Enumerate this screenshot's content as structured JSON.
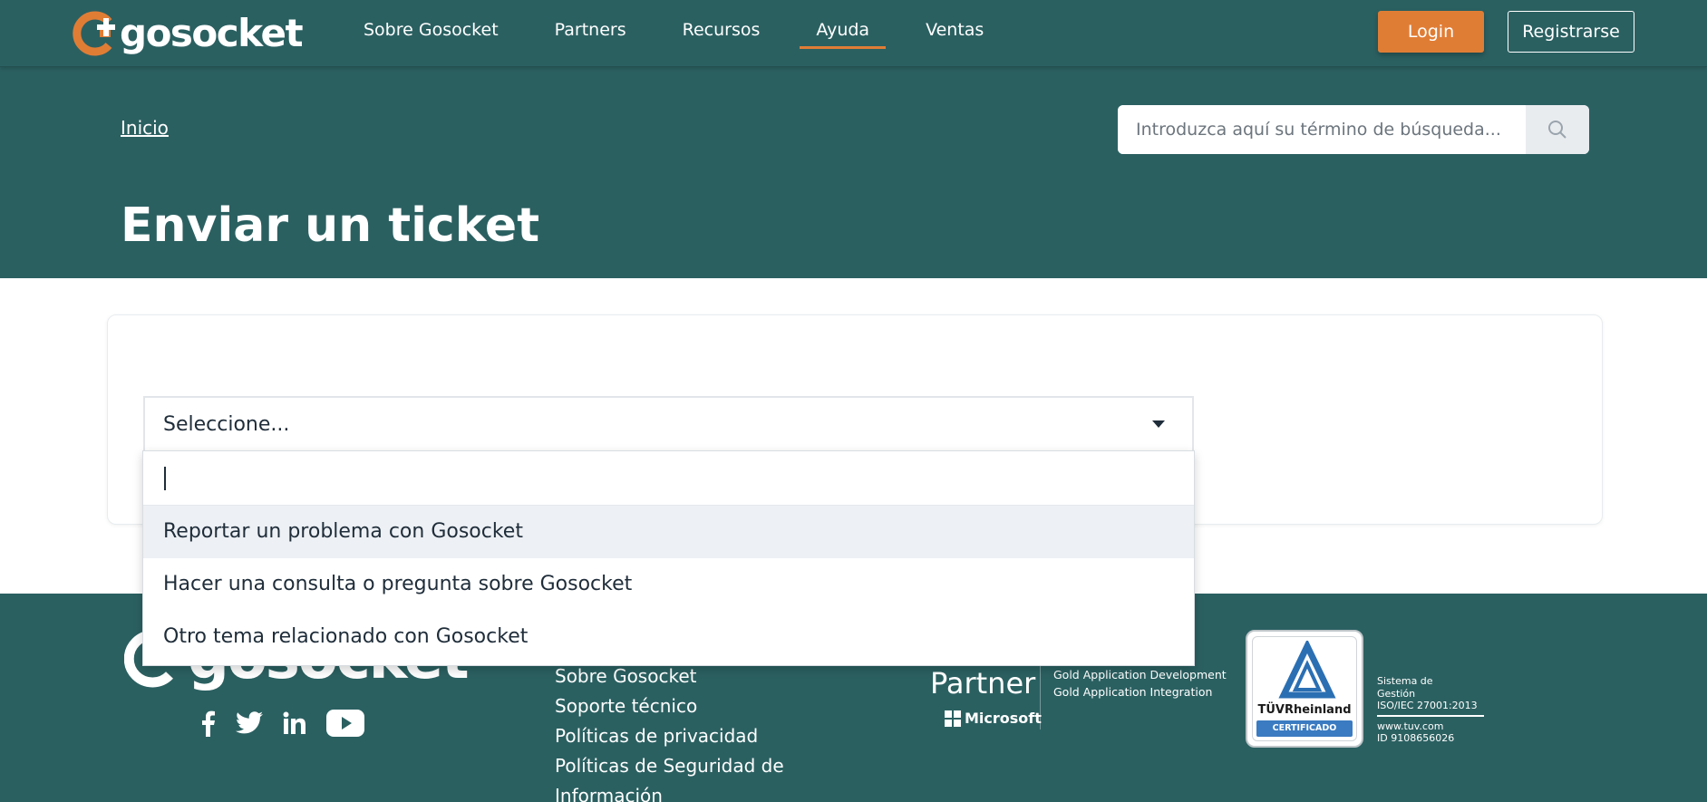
{
  "header": {
    "logo_text": "gosocket",
    "nav": [
      {
        "label": "Sobre Gosocket"
      },
      {
        "label": "Partners"
      },
      {
        "label": "Recursos"
      },
      {
        "label": "Ayuda"
      },
      {
        "label": "Ventas"
      }
    ],
    "active_nav": "Ayuda",
    "login_label": "Login",
    "register_label": "Registrarse",
    "accent_color": "#e07d35",
    "brand_color": "#2b6061"
  },
  "hero": {
    "breadcrumb": "Inicio",
    "search_placeholder": "Introduzca aquí su término de búsqueda...",
    "title": "Enviar un ticket"
  },
  "form": {
    "select_value": "Seleccione...",
    "search_value": "",
    "options": [
      {
        "label": "Reportar un problema con Gosocket",
        "highlighted": true
      },
      {
        "label": "Hacer una consulta o pregunta sobre Gosocket",
        "highlighted": false
      },
      {
        "label": "Otro tema relacionado con Gosocket",
        "highlighted": false
      }
    ]
  },
  "footer": {
    "logo_text": "gosocket",
    "links": [
      {
        "label": "Sobre Gosocket"
      },
      {
        "label": "Soporte técnico"
      },
      {
        "label": "Políticas de privacidad"
      },
      {
        "label": "Políticas de Seguridad de Información"
      }
    ],
    "partner_word": "Partner",
    "microsoft_label": "Microsoft",
    "gold_lines": [
      "Gold Application Development",
      "Gold Application Integration"
    ],
    "tuv_name": "TÜVRheinland",
    "tuv_cert": "CERTIFICADO",
    "iso_lines": [
      "Sistema de",
      "Gestión",
      "ISO/IEC 27001:2013"
    ],
    "tuv_url": "www.tuv.com",
    "tuv_id": "ID 9108656026",
    "social": [
      "facebook-icon",
      "twitter-icon",
      "linkedin-icon",
      "youtube-icon"
    ]
  }
}
